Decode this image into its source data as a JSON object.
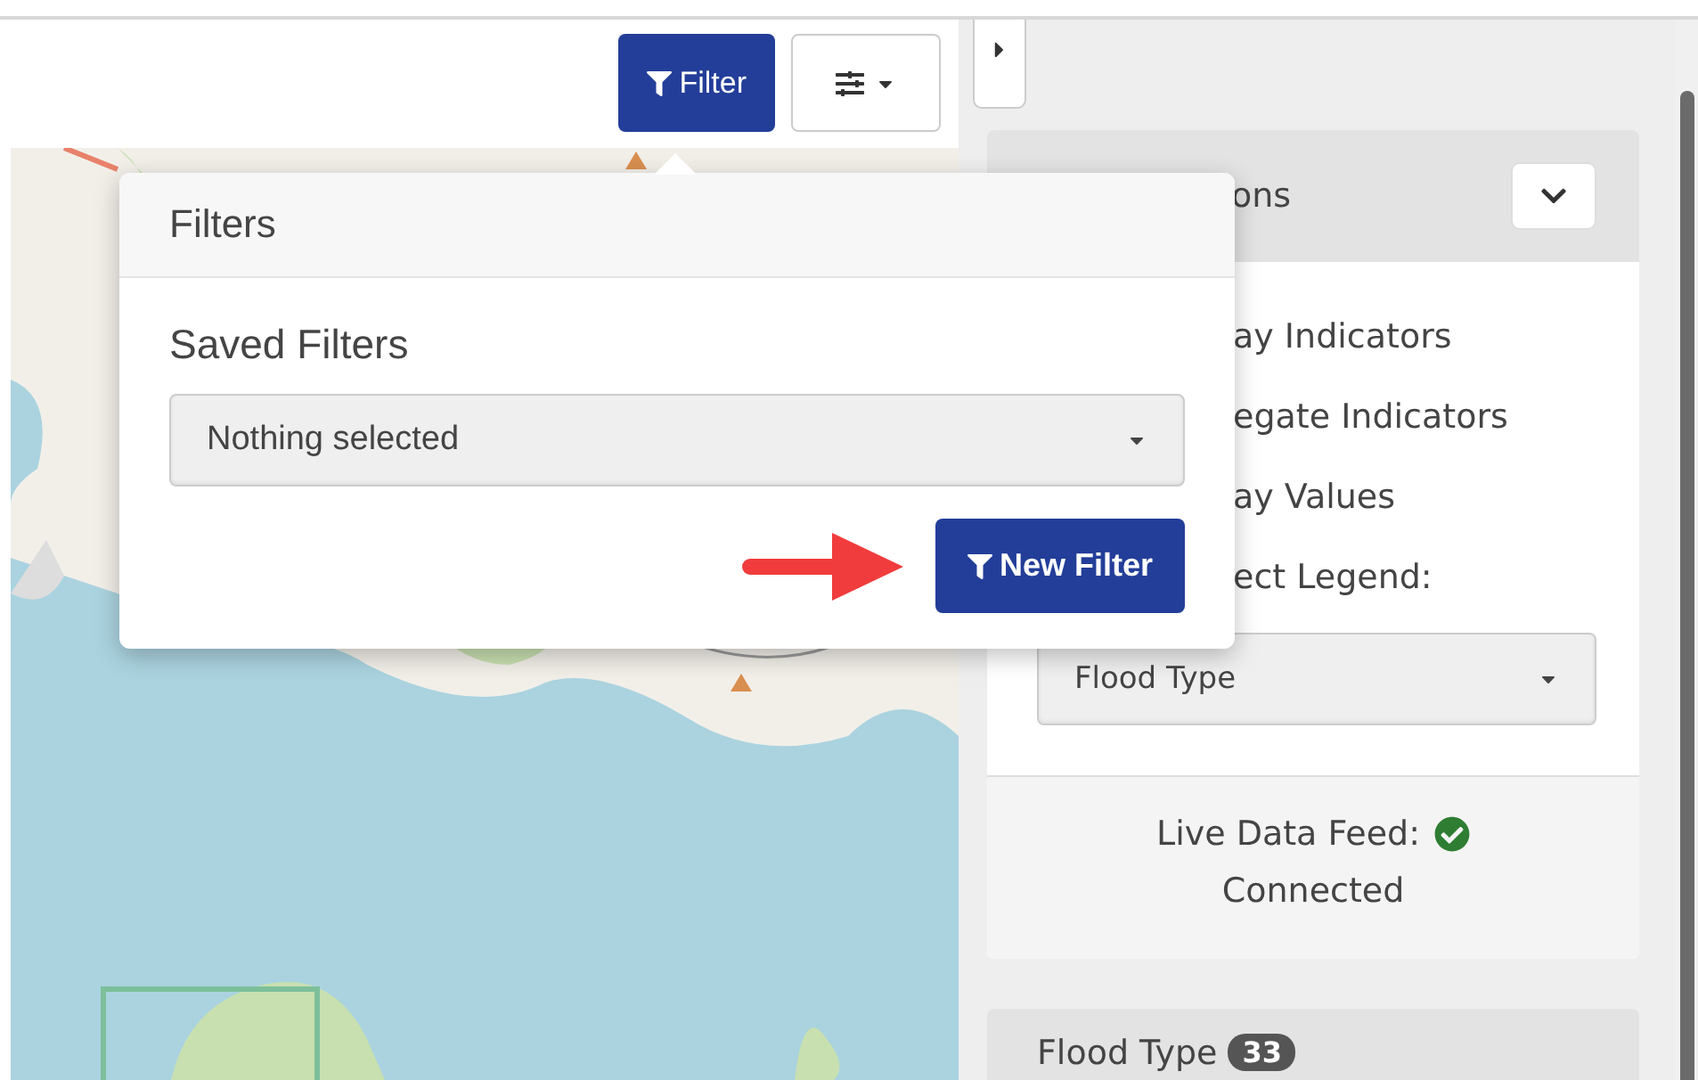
{
  "toolbar": {
    "filter_button": "Filter"
  },
  "filter_popover": {
    "title": "Filters",
    "saved_filters_label": "Saved Filters",
    "saved_filters_select": "Nothing selected",
    "new_filter_button": "New Filter"
  },
  "sidebar": {
    "options_card": {
      "title": "ons",
      "items": [
        "ay Indicators",
        "egate Indicators",
        "ay Values",
        "ect Legend:"
      ],
      "legend_select": "Flood Type",
      "feed_label": "Live Data Feed:",
      "feed_connected": true,
      "feed_status": "Connected"
    },
    "next_card": {
      "title": "Flood Type",
      "count": "33"
    }
  }
}
